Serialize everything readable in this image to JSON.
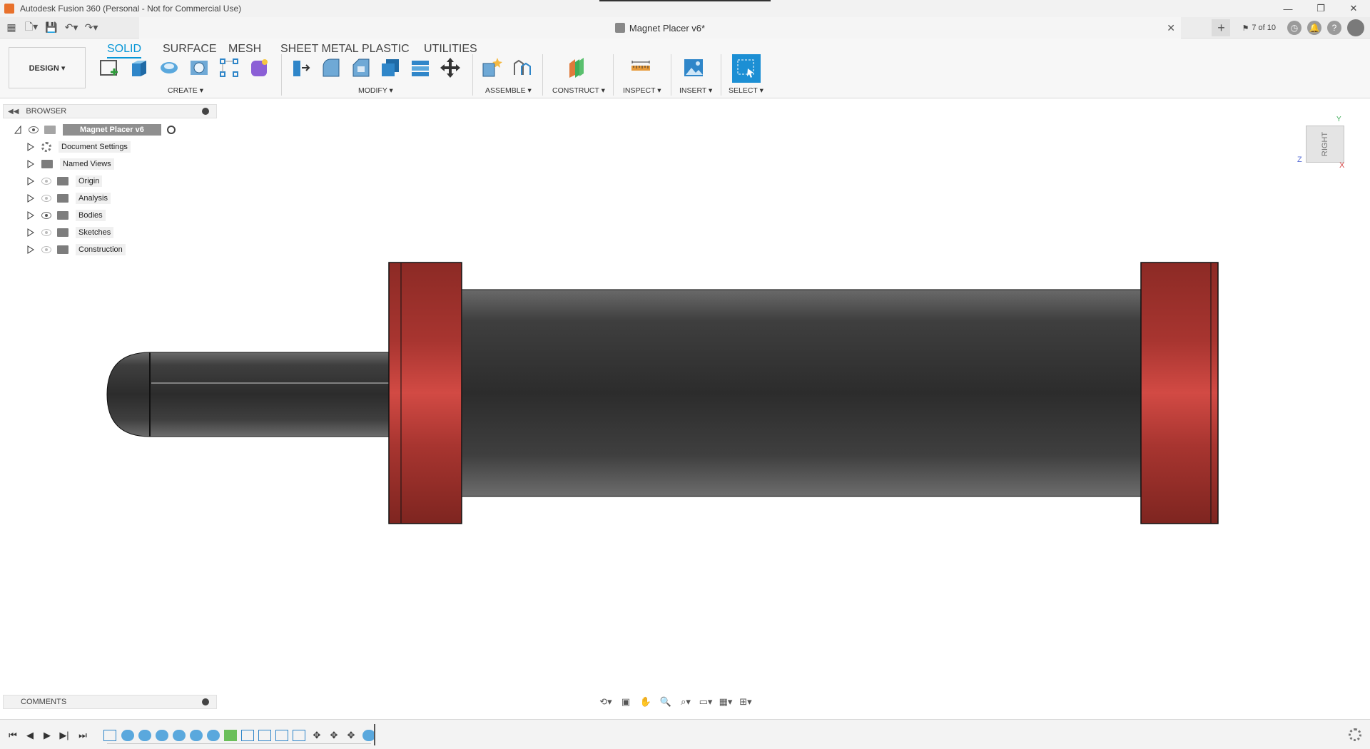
{
  "app": {
    "window_title": "Autodesk Fusion 360 (Personal - Not for Commercial Use)",
    "document_title": "Magnet Placer v6*",
    "job_status": "7 of 10"
  },
  "ribbon": {
    "workspace": "DESIGN ▾",
    "tabs": [
      "SOLID",
      "SURFACE",
      "MESH",
      "SHEET METAL",
      "PLASTIC",
      "UTILITIES"
    ],
    "groups": [
      "CREATE ▾",
      "MODIFY ▾",
      "ASSEMBLE ▾",
      "CONSTRUCT ▾",
      "INSPECT ▾",
      "INSERT ▾",
      "SELECT ▾"
    ]
  },
  "browser": {
    "title": "BROWSER",
    "root": "Magnet Placer v6",
    "items": [
      "Document Settings",
      "Named Views",
      "Origin",
      "Analysis",
      "Bodies",
      "Sketches",
      "Construction"
    ]
  },
  "viewcube": {
    "face": "RIGHT",
    "axes": [
      "Y",
      "Z",
      "X"
    ]
  },
  "comments": {
    "title": "COMMENTS"
  },
  "colors": {
    "accent": "#0696d7",
    "part_body": "#3a3a3a",
    "end_caps": "#b8342f"
  }
}
